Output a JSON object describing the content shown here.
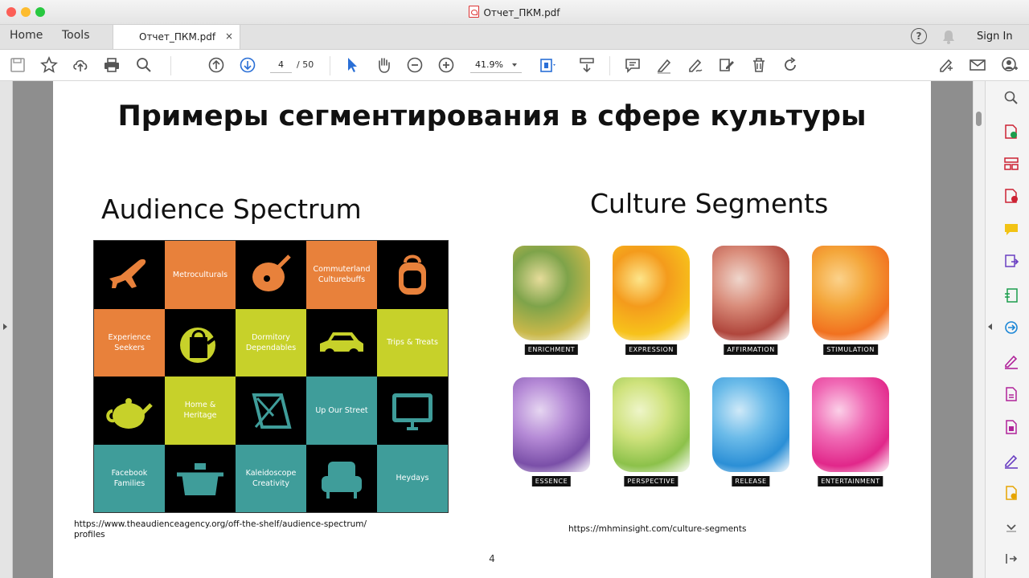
{
  "window": {
    "title": "Отчет_ПКМ.pdf"
  },
  "nav": {
    "home": "Home",
    "tools": "Tools",
    "doc_tab": "Отчет_ПКМ.pdf",
    "close": "×",
    "help": "?",
    "sign_in": "Sign In"
  },
  "toolbar": {
    "page_current": "4",
    "page_total": "/ 50",
    "zoom": "41.9%"
  },
  "slide": {
    "title": "Примеры сегментирования в сфере культуры",
    "left_heading": "Audience Spectrum",
    "right_heading": "Culture Segments",
    "left_url": "https://www.theaudienceagency.org/off-the-shelf/audience-spectrum/ profiles",
    "right_url": "https://mhminsight.com/culture-segments",
    "page_number": "4",
    "audience_cells": [
      {
        "icon": "airplane-icon",
        "bg": "#000000",
        "fg": "#e8813b"
      },
      {
        "label": "Metroculturals",
        "bg": "#e8813b"
      },
      {
        "icon": "guitar-icon",
        "bg": "#000000",
        "fg": "#e8813b"
      },
      {
        "label": "Commuterland Culturebuffs",
        "bg": "#e8813b"
      },
      {
        "icon": "backpack-icon",
        "bg": "#000000",
        "fg": "#e8813b"
      },
      {
        "label": "Experience Seekers",
        "bg": "#e8813b"
      },
      {
        "icon": "watering-can-icon",
        "bg": "#000000",
        "fg": "#c7d12a"
      },
      {
        "label": "Dormitory Dependables",
        "bg": "#c7d12a"
      },
      {
        "icon": "car-icon",
        "bg": "#000000",
        "fg": "#c7d12a"
      },
      {
        "label": "Trips & Treats",
        "bg": "#c7d12a"
      },
      {
        "icon": "teapot-icon",
        "bg": "#000000",
        "fg": "#c7d12a"
      },
      {
        "label": "Home & Heritage",
        "bg": "#c7d12a"
      },
      {
        "icon": "deckchair-icon",
        "bg": "#000000",
        "fg": "#3f9d9a"
      },
      {
        "label": "Up Our Street",
        "bg": "#3f9d9a"
      },
      {
        "icon": "tv-icon",
        "bg": "#000000",
        "fg": "#3f9d9a"
      },
      {
        "label": "Facebook Families",
        "bg": "#3f9d9a"
      },
      {
        "icon": "pot-icon",
        "bg": "#000000",
        "fg": "#3f9d9a"
      },
      {
        "label": "Kaleidoscope Creativity",
        "bg": "#3f9d9a"
      },
      {
        "icon": "armchair-icon",
        "bg": "#000000",
        "fg": "#3f9d9a"
      },
      {
        "label": "Heydays",
        "bg": "#3f9d9a"
      }
    ],
    "culture_segments": [
      {
        "label": "ENRICHMENT",
        "colors": [
          "#c9b84a",
          "#7ea34a",
          "#e6dc9a"
        ]
      },
      {
        "label": "EXPRESSION",
        "colors": [
          "#f7c21b",
          "#f49b1c",
          "#fde58a"
        ]
      },
      {
        "label": "AFFIRMATION",
        "colors": [
          "#b0463c",
          "#d98c7a",
          "#efd6cc"
        ]
      },
      {
        "label": "STIMULATION",
        "colors": [
          "#f1711f",
          "#f4a63a",
          "#fbd28b"
        ]
      },
      {
        "label": "ESSENCE",
        "colors": [
          "#7a4fa8",
          "#b58ad6",
          "#e6d6f1"
        ]
      },
      {
        "label": "PERSPECTIVE",
        "colors": [
          "#8cc14a",
          "#cfe27c",
          "#eef5c9"
        ]
      },
      {
        "label": "RELEASE",
        "colors": [
          "#2b8fd6",
          "#6bbbe9",
          "#cfe9f8"
        ]
      },
      {
        "label": "ENTERTAINMENT",
        "colors": [
          "#e1278a",
          "#f06ab5",
          "#fbd0e8"
        ]
      }
    ]
  }
}
